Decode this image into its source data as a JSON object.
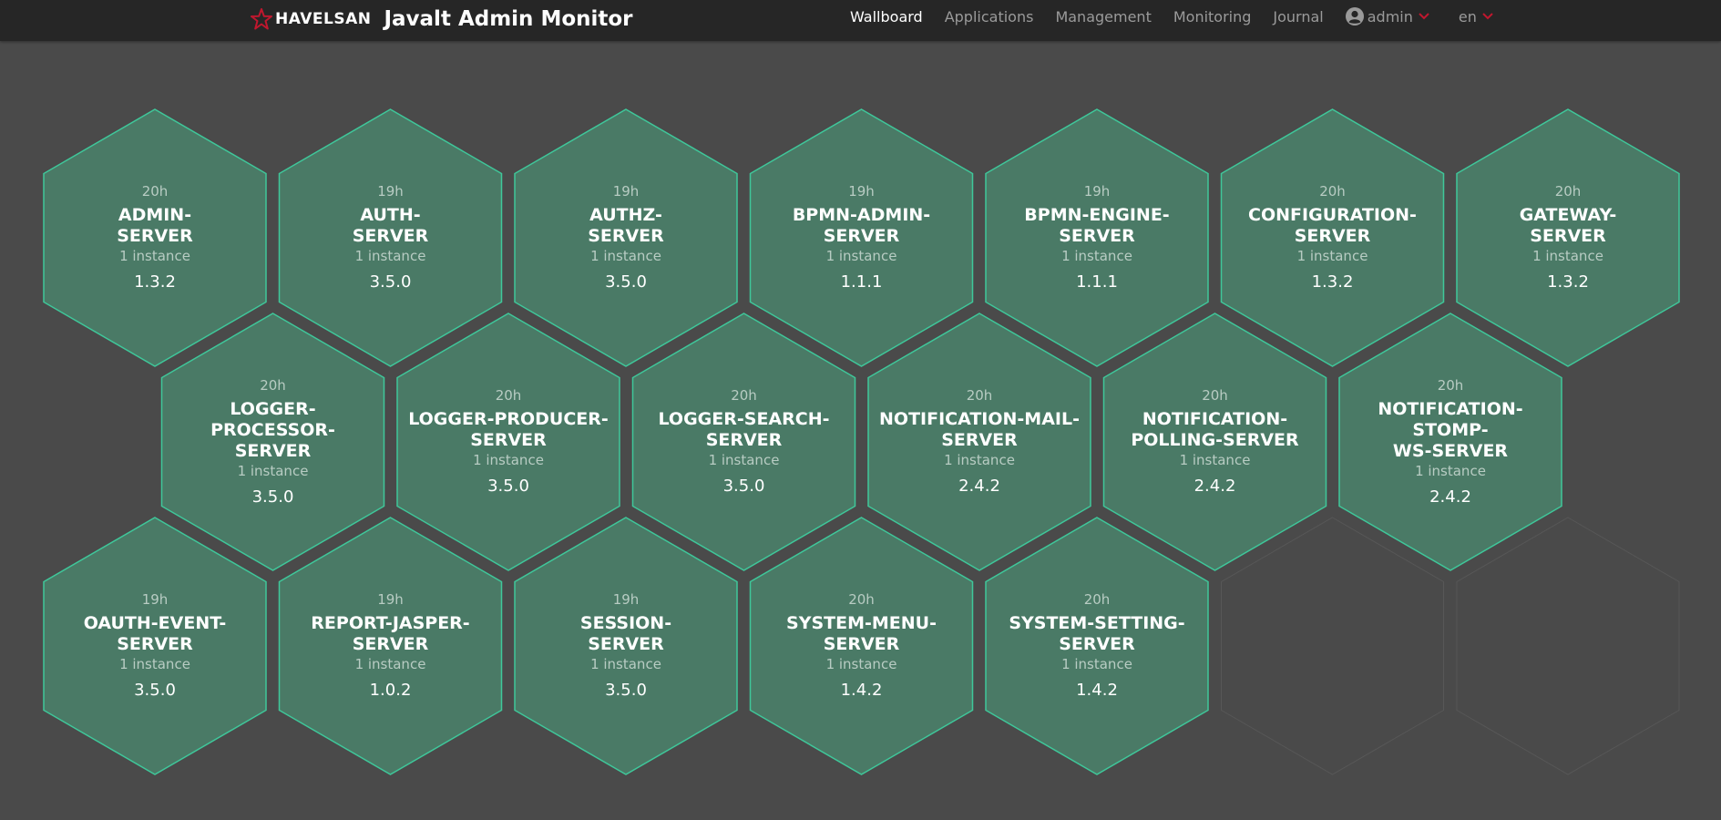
{
  "header": {
    "company": "HAVELSAN",
    "title": "Javalt Admin Monitor",
    "nav": [
      {
        "label": "Wallboard",
        "active": true
      },
      {
        "label": "Applications",
        "active": false
      },
      {
        "label": "Management",
        "active": false
      },
      {
        "label": "Monitoring",
        "active": false
      },
      {
        "label": "Journal",
        "active": false
      }
    ],
    "user": "admin",
    "language": "en",
    "accent_color": "#c0172e"
  },
  "wallboard": {
    "colors": {
      "fill": "#4a7a66",
      "stroke": "#3fc79a",
      "empty_stroke": "#575757"
    },
    "rows": [
      [
        {
          "uptime": "20h",
          "name": "ADMIN-\nSERVER",
          "instances": "1 instance",
          "version": "1.3.2"
        },
        {
          "uptime": "19h",
          "name": "AUTH-\nSERVER",
          "instances": "1 instance",
          "version": "3.5.0"
        },
        {
          "uptime": "19h",
          "name": "AUTHZ-\nSERVER",
          "instances": "1 instance",
          "version": "3.5.0"
        },
        {
          "uptime": "19h",
          "name": "BPMN-ADMIN-\nSERVER",
          "instances": "1 instance",
          "version": "1.1.1"
        },
        {
          "uptime": "19h",
          "name": "BPMN-ENGINE-\nSERVER",
          "instances": "1 instance",
          "version": "1.1.1"
        },
        {
          "uptime": "20h",
          "name": "CONFIGURATION-\nSERVER",
          "instances": "1 instance",
          "version": "1.3.2"
        },
        {
          "uptime": "20h",
          "name": "GATEWAY-\nSERVER",
          "instances": "1 instance",
          "version": "1.3.2"
        }
      ],
      [
        {
          "uptime": "20h",
          "name": "LOGGER-PROCESSOR-\nSERVER",
          "instances": "1 instance",
          "version": "3.5.0"
        },
        {
          "uptime": "20h",
          "name": "LOGGER-PRODUCER-\nSERVER",
          "instances": "1 instance",
          "version": "3.5.0"
        },
        {
          "uptime": "20h",
          "name": "LOGGER-SEARCH-\nSERVER",
          "instances": "1 instance",
          "version": "3.5.0"
        },
        {
          "uptime": "20h",
          "name": "NOTIFICATION-MAIL-\nSERVER",
          "instances": "1 instance",
          "version": "2.4.2"
        },
        {
          "uptime": "20h",
          "name": "NOTIFICATION-\nPOLLING-SERVER",
          "instances": "1 instance",
          "version": "2.4.2"
        },
        {
          "uptime": "20h",
          "name": "NOTIFICATION-STOMP-\nWS-SERVER",
          "instances": "1 instance",
          "version": "2.4.2"
        }
      ],
      [
        {
          "uptime": "19h",
          "name": "OAUTH-EVENT-\nSERVER",
          "instances": "1 instance",
          "version": "3.5.0"
        },
        {
          "uptime": "19h",
          "name": "REPORT-JASPER-\nSERVER",
          "instances": "1 instance",
          "version": "1.0.2"
        },
        {
          "uptime": "19h",
          "name": "SESSION-\nSERVER",
          "instances": "1 instance",
          "version": "3.5.0"
        },
        {
          "uptime": "20h",
          "name": "SYSTEM-MENU-\nSERVER",
          "instances": "1 instance",
          "version": "1.4.2"
        },
        {
          "uptime": "20h",
          "name": "SYSTEM-SETTING-\nSERVER",
          "instances": "1 instance",
          "version": "1.4.2"
        },
        null,
        null
      ]
    ]
  }
}
